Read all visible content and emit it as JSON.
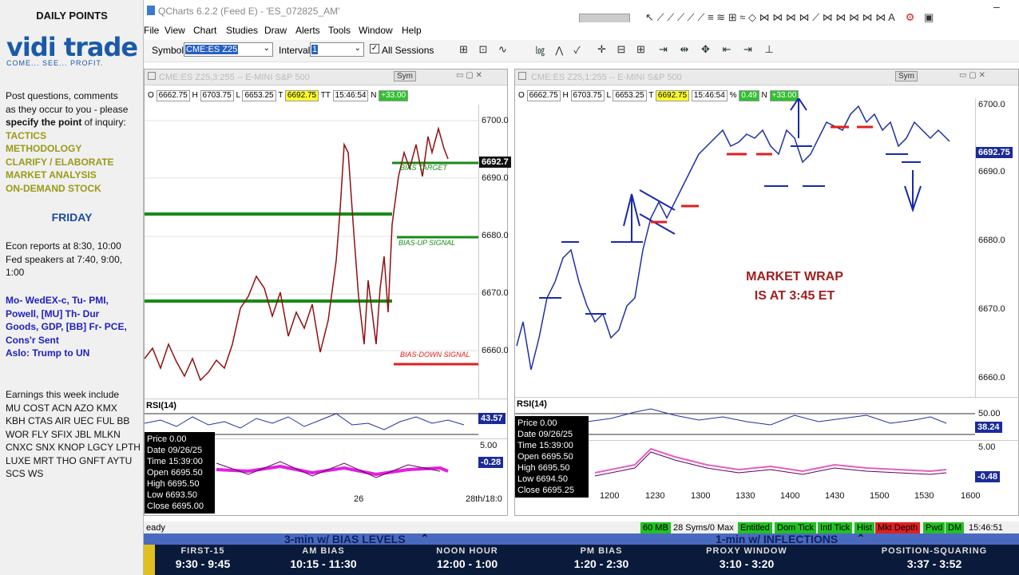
{
  "left_panel": {
    "header": "DAILY POINTS",
    "logo_text": "vidi trade",
    "logo_tag": "COME... SEE... PROFIT.",
    "intro_1": "Post questions, comments",
    "intro_2": "as they occur to you - please",
    "intro_3a": "specify the point",
    "intro_3b": " of inquiry:",
    "topics": [
      "TACTICS",
      "METHODOLOGY",
      "CLARIFY / ELABORATE",
      "MARKET ANALYSIS",
      "ON-DEMAND STOCK"
    ],
    "day": "FRIDAY",
    "econ_1": "Econ reports at 8:30, 10:00",
    "econ_2": "Fed speakers at 7:40, 9:00,",
    "econ_3": "1:00",
    "week_1": "Mo- WedEX-c, Tu- PMI,",
    "week_2": "Powell, [MU] Th- Dur",
    "week_3": "Goods, GDP, [BB] Fr- PCE,",
    "week_4": "Cons'r Sent",
    "week_5": "Aslo: Trump to UN",
    "earn_title": "Earnings this week include",
    "earn_1": "MU COST ACN AZO KMX",
    "earn_2": "KBH CTAS AIR UEC FUL BB",
    "earn_3": "WOR FLY SFIX JBL MLKN",
    "earn_4": "CNXC SNX KNOP LGCY LPTH",
    "earn_5": "LUXE MRT THO GNFT AYTU",
    "earn_6": "SCS WS"
  },
  "window": {
    "title": "QCharts 6.2.2 (Feed E) - 'ES_072825_AM'",
    "menus": [
      "File",
      "View",
      "Chart",
      "Studies",
      "Draw",
      "Alerts",
      "Tools",
      "Window",
      "Help"
    ],
    "symbol_label": "Symbol",
    "symbol_value": "CME:ES Z25",
    "interval_label": "Interval",
    "interval_value": "1",
    "all_sessions": "All Sessions"
  },
  "chart_left": {
    "title": "CME:ES Z25,3:255 -- E-MINI S&P 500",
    "sym": "Sym",
    "o": "O",
    "o_val": "6662.75",
    "h": "H",
    "h_val": "6703.75",
    "l": "L",
    "l_val": "6653.25",
    "t": "T",
    "t_val": "6692.75",
    "tt": "TT",
    "tt_val": "15:46:54",
    "n": "N",
    "n_val": "+33.00",
    "prices": [
      "6700.0",
      "6690.0",
      "6680.0",
      "6670.0",
      "6660.0"
    ],
    "last_price": "6692.7",
    "lbl_target": "BIAS TARGET",
    "lbl_up": "BIAS-UP SIGNAL",
    "lbl_down": "BIAS-DOWN SIGNAL",
    "rsi": "RSI(14)",
    "rsi_val": "43.57",
    "rsi_50": "50.00",
    "macd_5": "5.00",
    "macd_val": "-0.28",
    "x_26": "26",
    "x_28": "28th/18:0",
    "data_panel": {
      "price": "Price",
      "price_v": "0.00",
      "date": "Date",
      "date_v": "09/26/25",
      "time": "Time",
      "time_v": "15:39:00",
      "open": "Open",
      "open_v": "6695.50",
      "high": "High",
      "high_v": "6695.50",
      "low": "Low",
      "low_v": "6693.50",
      "close": "Close",
      "close_v": "6695.00"
    }
  },
  "chart_right": {
    "title": "CME:ES Z25,1:255 -- E-MINI S&P 500",
    "sym": "Sym",
    "o_val": "6662.75",
    "h_val": "6703.75",
    "l_val": "6653.25",
    "t_val": "6692.75",
    "tt_val": "15:46:54",
    "pct": "%",
    "pct_val": "0.49",
    "n_val": "+33.00",
    "prices": [
      "6700.0",
      "6690.0",
      "6680.0",
      "6670.0",
      "6660.0"
    ],
    "last_price": "6692.75",
    "wrap_1": "MARKET WRAP",
    "wrap_2": "IS AT 3:45 ET",
    "rsi": "RSI(14)",
    "rsi_val": "38.24",
    "rsi_50": "50.00",
    "macd_5": "5.00",
    "macd_val": "-0.48",
    "x_ticks": [
      "1200",
      "1230",
      "1300",
      "1330",
      "1400",
      "1430",
      "1500",
      "1530",
      "1600"
    ],
    "data_panel": {
      "price": "Price",
      "price_v": "0.00",
      "date": "Date",
      "date_v": "09/26/25",
      "time": "Time",
      "time_v": "15:39:00",
      "open": "Open",
      "open_v": "6695.50",
      "high": "High",
      "high_v": "6695.50",
      "low": "Low",
      "low_v": "6694.50",
      "close": "Close",
      "close_v": "6695.25"
    }
  },
  "status": {
    "ready": "eady",
    "mem": "60 MB",
    "syms": "28 Syms/0 Max",
    "entitled": "Entitled",
    "domtick": "Dom Tick",
    "intltick": "Intl Tick",
    "hist": "Hist",
    "mktdepth": "Mkt Depth",
    "pwd": "Pwd",
    "dm": "DM",
    "clock": "15:46:51 EDT"
  },
  "banner": {
    "left_title": "3-min w/ BIAS LEVELS",
    "right_title": "1-min w/ INFLECTIONS",
    "segments": [
      {
        "label": "FIRST-15",
        "time": "9:30 - 9:45"
      },
      {
        "label": "AM BIAS",
        "time": "10:15 - 11:30"
      },
      {
        "label": "NOON HOUR",
        "time": "12:00 - 1:00"
      },
      {
        "label": "PM BIAS",
        "time": "1:20 - 2:30"
      },
      {
        "label": "PROXY WINDOW",
        "time": "3:10 - 3:20"
      },
      {
        "label": "POSITION-SQUARING",
        "time": "3:37 - 3:52"
      }
    ]
  },
  "colors": {
    "accent": "#1a5aa8",
    "olive": "#9a9a18",
    "price_box": "#1b2b9a",
    "bias_green": "#2a8a2a",
    "bias_red": "#e02020",
    "macd_magenta": "#e020e0"
  }
}
